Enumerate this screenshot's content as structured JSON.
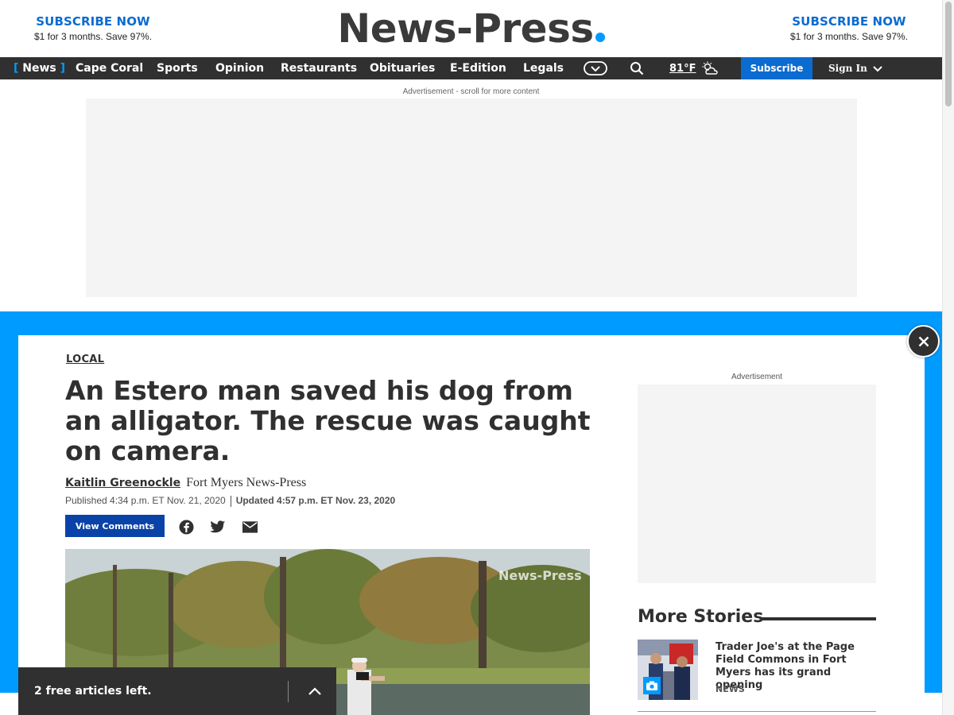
{
  "masthead": {
    "promo_left": {
      "title": "SUBSCRIBE NOW",
      "subtitle": "$1 for 3 months. Save 97%."
    },
    "promo_right": {
      "title": "SUBSCRIBE NOW",
      "subtitle": "$1 for 3 months. Save 97%."
    },
    "logo": "News-Press"
  },
  "nav": {
    "items": [
      "News",
      "Cape Coral",
      "Sports",
      "Opinion",
      "Restaurants",
      "Obituaries",
      "E-Edition",
      "Legals"
    ],
    "active_open_bracket": "[",
    "active_close_bracket": "]",
    "temperature": "81°F",
    "weather_icon": "partly-cloudy-icon",
    "subscribe": "Subscribe",
    "sign_in": "Sign In"
  },
  "ads": {
    "top_label": "Advertisement - scroll for more content",
    "rail_label": "Advertisement"
  },
  "article": {
    "section": "LOCAL",
    "headline": "An Estero man saved his dog from an alligator. The rescue was caught on camera.",
    "author": "Kaitlin Greenockle",
    "outlet": "Fort Myers News-Press",
    "published": "Published 4:34 p.m. ET Nov. 21, 2020",
    "updated": "Updated 4:57 p.m. ET Nov. 23, 2020",
    "comments_button": "View Comments",
    "video_watermark": "News-Press"
  },
  "more_stories": {
    "title": "More Stories",
    "items": [
      {
        "title": "Trader Joe's at the Page Field Commons in Fort Myers has its grand opening",
        "tag": "NEWS"
      }
    ]
  },
  "meter": {
    "text": "2 free articles left."
  },
  "colors": {
    "brand_blue": "#009bff",
    "nav_dark": "#303030",
    "subscribe_blue": "#0a6bd1",
    "comments_blue": "#0a43a8"
  }
}
